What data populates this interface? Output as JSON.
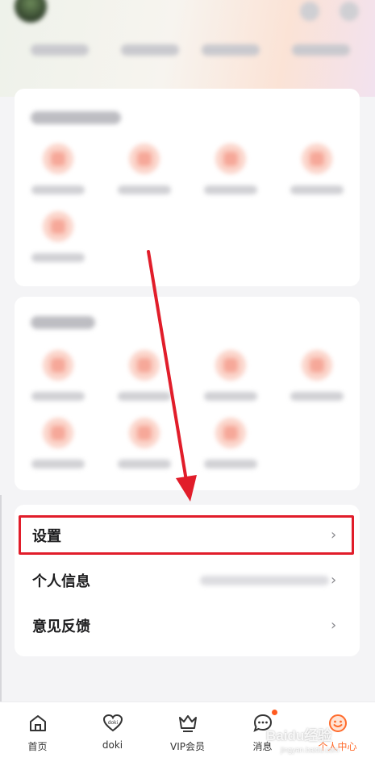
{
  "settings_list": {
    "items": [
      {
        "label": "设置"
      },
      {
        "label": "个人信息"
      },
      {
        "label": "意见反馈"
      }
    ],
    "chevron": "›"
  },
  "tabbar": {
    "tabs": [
      {
        "label": "首页",
        "icon": "home-icon"
      },
      {
        "label": "doki",
        "icon": "doki-heart-icon"
      },
      {
        "label": "VIP会员",
        "icon": "vip-crown-icon"
      },
      {
        "label": "消息",
        "icon": "message-icon"
      },
      {
        "label": "个人中心",
        "icon": "smiley-icon"
      }
    ],
    "active_color": "#ff6b2c"
  },
  "annotation": {
    "highlight_color": "#e11d2a"
  },
  "watermark": {
    "title": "Baidu经验",
    "sub": "jingyan.baidu.com"
  }
}
